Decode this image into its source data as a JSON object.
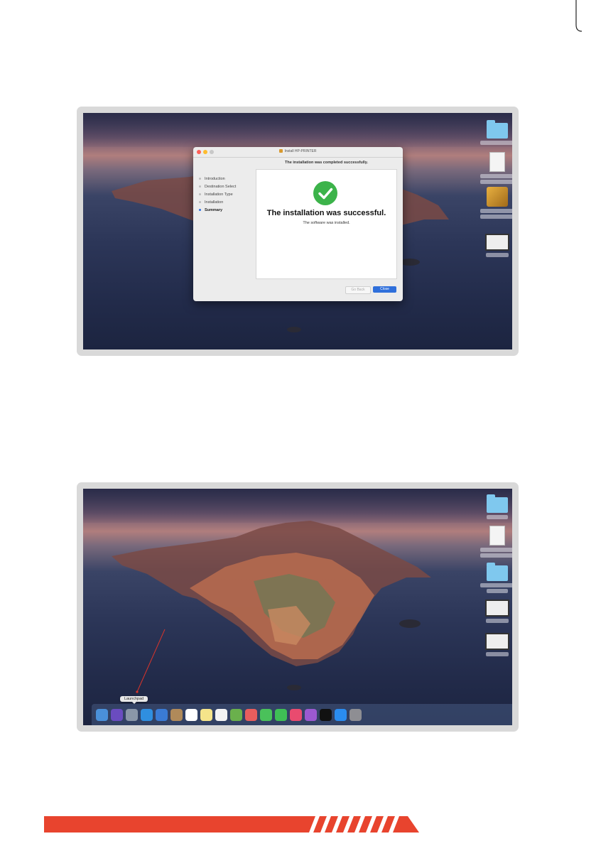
{
  "colors": {
    "accent": "#e8442e",
    "success_green": "#3cb34a",
    "primary_button": "#2f6fdb",
    "folder_blue": "#7fc8ee"
  },
  "installer": {
    "window_title": "Install HP-PRINTER",
    "header": "The installation was completed successfully.",
    "steps": [
      {
        "label": "Introduction",
        "active": false
      },
      {
        "label": "Destination Select",
        "active": false
      },
      {
        "label": "Installation Type",
        "active": false
      },
      {
        "label": "Installation",
        "active": false
      },
      {
        "label": "Summary",
        "active": true
      }
    ],
    "success_title": "The installation was successful.",
    "success_subtitle": "The software was installed.",
    "back_button": "Go Back",
    "close_button": "Close"
  },
  "desktop_icons_1": [
    {
      "type": "folder",
      "icon": "folder-icon"
    },
    {
      "type": "document",
      "icon": "document-icon"
    },
    {
      "type": "package",
      "icon": "package-icon"
    },
    {
      "type": "screenshot",
      "icon": "screenshot-icon"
    }
  ],
  "desktop_icons_2": [
    {
      "type": "folder",
      "icon": "folder-icon"
    },
    {
      "type": "document",
      "icon": "document-icon"
    },
    {
      "type": "folder",
      "icon": "folder-icon"
    },
    {
      "type": "screenshot",
      "icon": "screenshot-icon"
    },
    {
      "type": "screenshot",
      "icon": "screenshot-icon"
    }
  ],
  "dock": {
    "tooltip": "Launchpad",
    "apps": [
      "finder-icon",
      "siri-icon",
      "launchpad-icon",
      "safari-icon",
      "mail-icon",
      "contacts-icon",
      "calendar-icon",
      "notes-icon",
      "reminders-icon",
      "maps-icon",
      "photos-icon",
      "messages-icon",
      "facetime-icon",
      "music-icon",
      "podcasts-icon",
      "tv-icon",
      "app-store-icon",
      "system-preferences-icon"
    ],
    "app_colors": [
      "#4a90d9",
      "#6a4cc0",
      "#8a96a8",
      "#2f8fe0",
      "#3a7bd5",
      "#b08a5a",
      "#ffffff",
      "#f5e48a",
      "#f3f3f3",
      "#6ab04c",
      "#e85d5d",
      "#4ac15a",
      "#3fbf55",
      "#e94b6f",
      "#9b59d0",
      "#111111",
      "#2a8cf0",
      "#8e8e93"
    ]
  }
}
